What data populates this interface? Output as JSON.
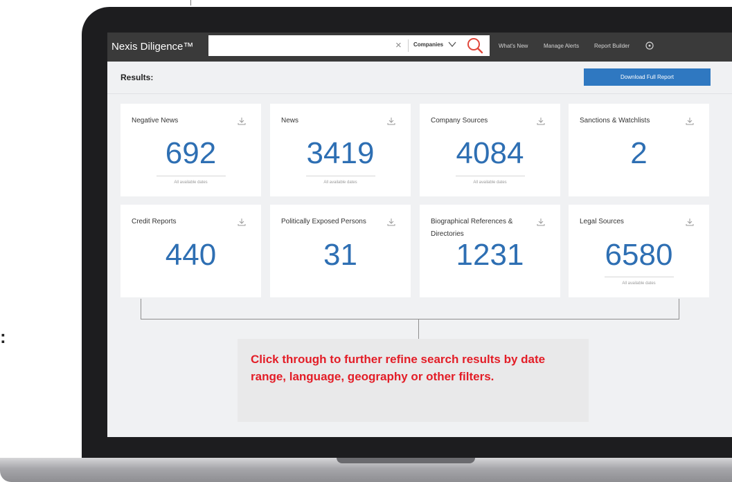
{
  "window": {
    "side_mark": ":"
  },
  "topbar": {
    "brand": "Nexis Diligence™",
    "search": {
      "value": "",
      "clear_glyph": "×",
      "type_label": "Companies"
    },
    "nav": [
      "What's New",
      "Manage Alerts",
      "Report Builder"
    ]
  },
  "results": {
    "title": "Results:",
    "download_label": "Download Full Report"
  },
  "cards": [
    {
      "title": "Negative News",
      "count": "692",
      "dates": "All available dates"
    },
    {
      "title": "News",
      "count": "3419",
      "dates": "All available dates"
    },
    {
      "title": "Company Sources",
      "count": "4084",
      "dates": "All available dates"
    },
    {
      "title": "Sanctions & Watchlists",
      "count": "2",
      "dates": ""
    },
    {
      "title": "Credit Reports",
      "count": "440",
      "dates": ""
    },
    {
      "title": "Politically Exposed Persons",
      "count": "31",
      "dates": ""
    },
    {
      "title": "Biographical References & Directories",
      "count": "1231",
      "dates": ""
    },
    {
      "title": "Legal Sources",
      "count": "6580",
      "dates": "All available dates"
    }
  ],
  "callout": {
    "text": "Click through to further refine search results by date range, language, geography or other filters."
  },
  "colors": {
    "accent": "#2f78c1",
    "count": "#2e6fb3",
    "callout_text": "#e31d27",
    "search_icon": "#e0463a"
  },
  "icons": [
    "search-icon",
    "chevron-down-icon",
    "close-icon",
    "help-icon",
    "download-icon"
  ]
}
